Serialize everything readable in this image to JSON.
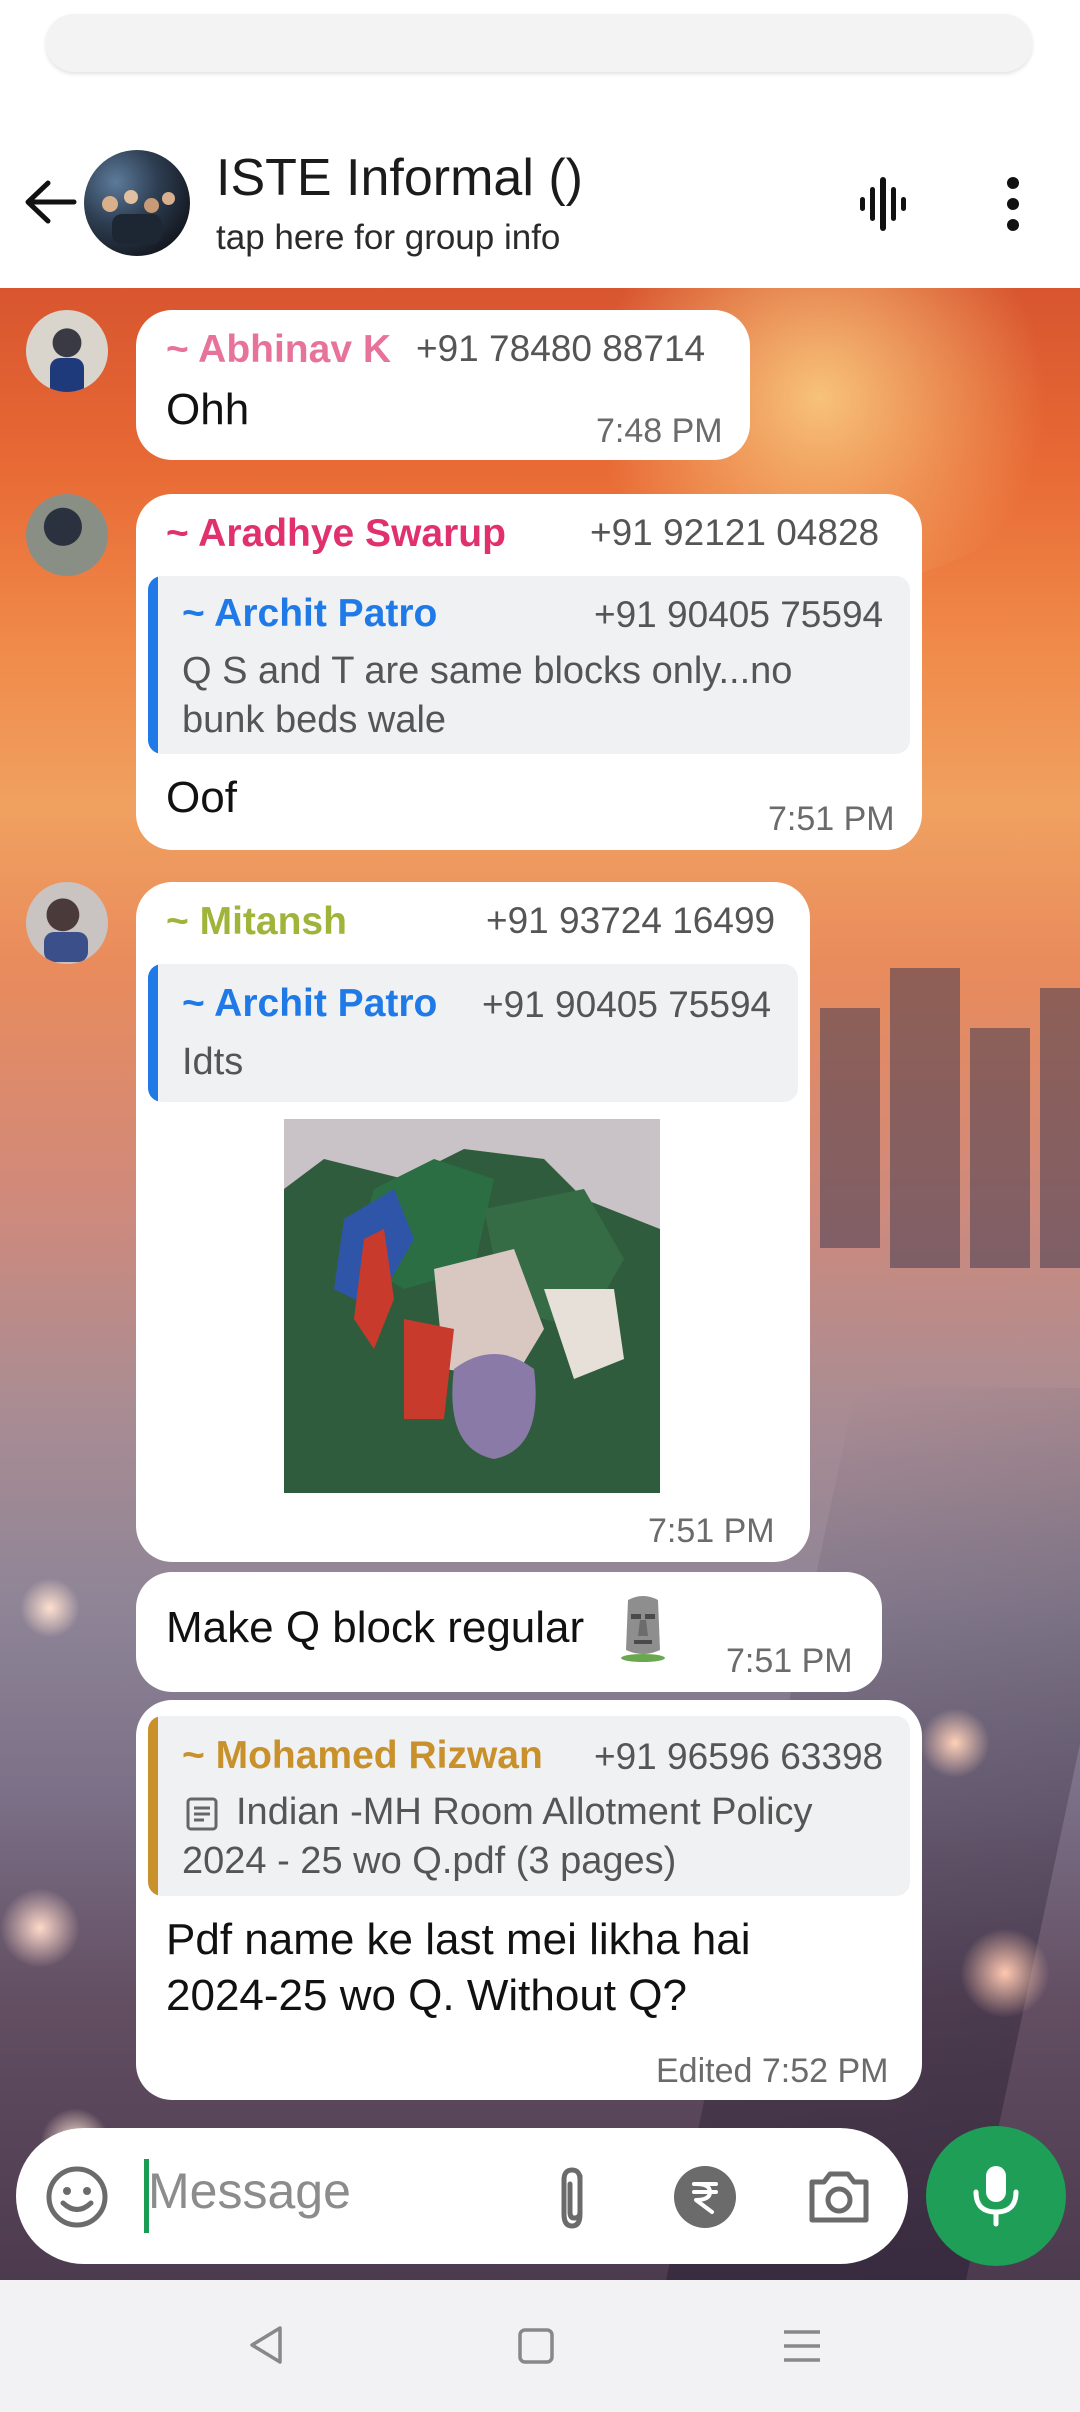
{
  "header": {
    "title": "ISTE Informal ()",
    "subtitle": "tap here for group info"
  },
  "messages": [
    {
      "sender": "~ Abhinav K",
      "phone": "+91 78480 88714",
      "text": "Ohh",
      "time": "7:48 PM",
      "sender_color": "#e8739a"
    },
    {
      "sender": "~ Aradhye Swarup",
      "phone": "+91 92121 04828",
      "quote": {
        "sender": "~ Archit Patro",
        "phone": "+91 90405 75594",
        "text_line1": "Q S and T are same blocks only...no",
        "text_line2": "bunk beds wale"
      },
      "text": "Oof",
      "time": "7:51 PM",
      "sender_color": "#e0306d"
    },
    {
      "sender": "~ Mitansh",
      "phone": "+91 93724 16499",
      "quote": {
        "sender": "~ Archit Patro",
        "phone": "+91 90405 75594",
        "text": "Idts"
      },
      "attachment": "sticker",
      "time": "7:51 PM",
      "sender_color": "#a0b43a"
    },
    {
      "text": "Make Q block regular",
      "emoji": "moai",
      "time": "7:51 PM"
    },
    {
      "quote": {
        "sender": "~ Mohamed Rizwan",
        "phone": "+91 96596 63398",
        "doc_line1": "Indian -MH Room Allotment Policy",
        "doc_line2": "2024 - 25 wo Q.pdf (3 pages)",
        "bar_color": "#c8912c"
      },
      "text_line1": "Pdf name ke last mei likha hai",
      "text_line2": "2024-25 wo Q. Without Q?",
      "time": "Edited 7:52 PM"
    }
  ],
  "composer": {
    "placeholder": "Message"
  },
  "colors": {
    "quote_blue": "#1f7ae8",
    "fab_green": "#1e9e57"
  }
}
